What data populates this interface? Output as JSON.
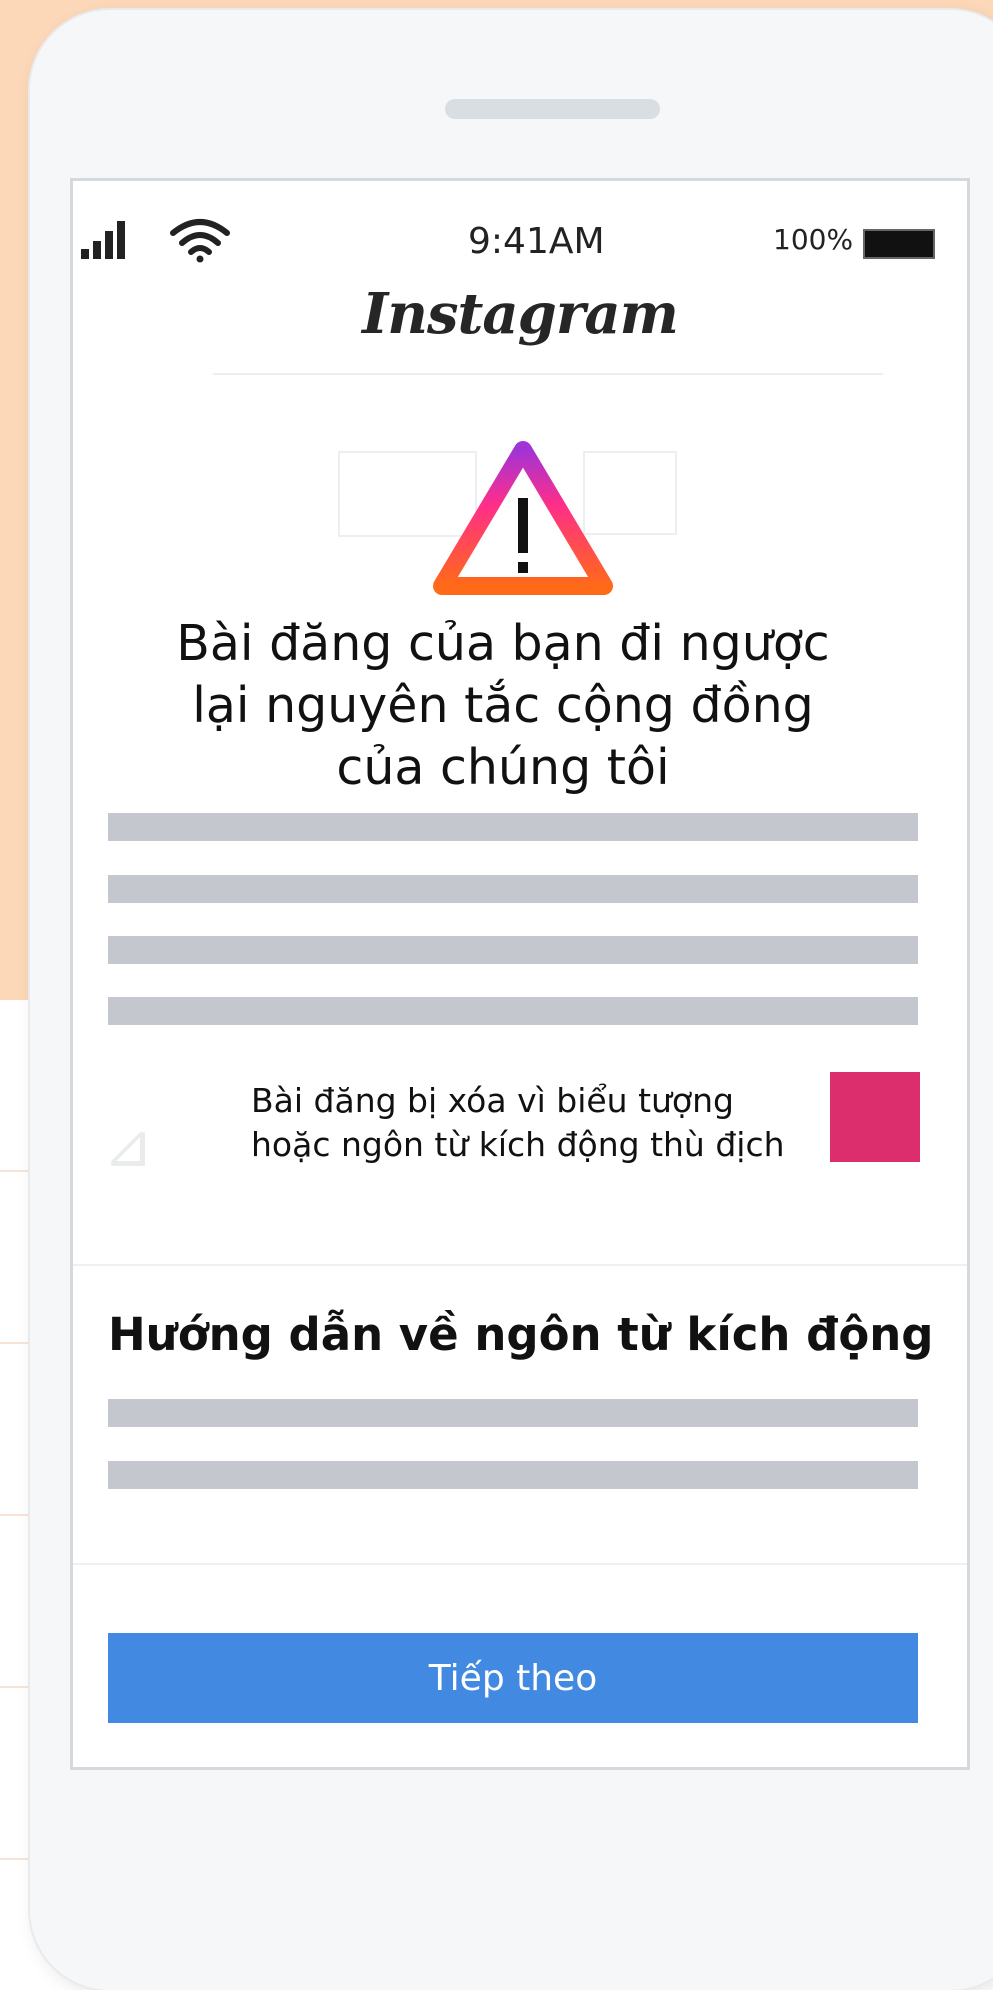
{
  "status_bar": {
    "time": "9:41AM",
    "battery_percent": "100%",
    "signal_icon": "signal-bars-icon",
    "wifi_icon": "wifi-icon",
    "battery_icon": "battery-icon"
  },
  "header": {
    "app_name": "Instagram"
  },
  "warning": {
    "icon": "warning-triangle-icon",
    "title": "Bài đăng của bạn đi ngược lại nguyên tắc cộng đồng của chúng tôi",
    "gradient_colors": [
      "#a233d6",
      "#ff2e8a",
      "#ff6a18"
    ]
  },
  "reason": {
    "text_line1": "Bài đăng bị xóa vì biểu tượng",
    "text_line2": "hoặc ngôn từ kích động thù địch",
    "swatch_color": "#dc2e6c"
  },
  "guidelines": {
    "heading": "Hướng dẫn về ngôn từ kích động"
  },
  "actions": {
    "next_label": "Tiếp theo",
    "next_color": "#4289e1"
  }
}
